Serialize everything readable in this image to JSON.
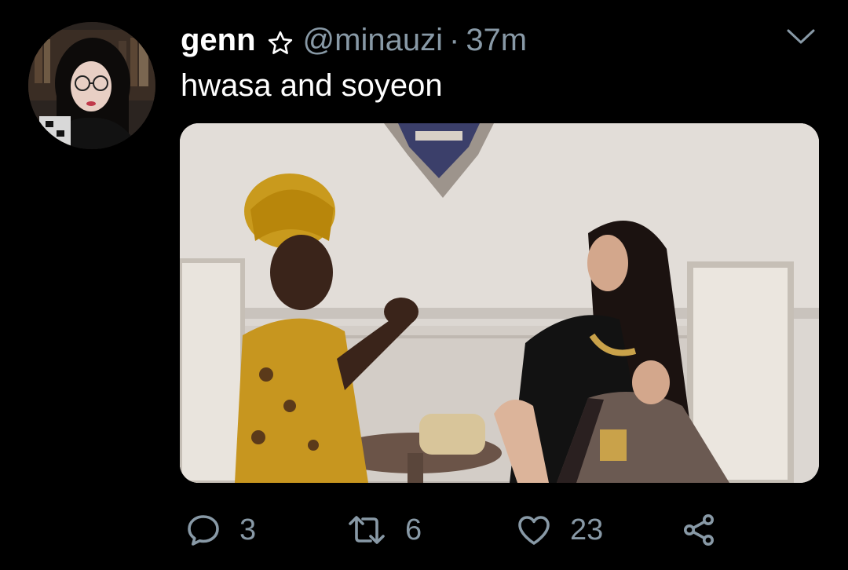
{
  "tweet": {
    "author": {
      "display_name": "genn",
      "badge_icon": "star-outline-icon",
      "handle": "@minauzi",
      "separator": "·",
      "timestamp": "37m"
    },
    "text": "hwasa and soyeon",
    "media": {
      "kind": "photo"
    },
    "actions": {
      "reply_count": "3",
      "retweet_count": "6",
      "like_count": "23"
    }
  },
  "colors": {
    "background": "#000000",
    "primary_text": "#ffffff",
    "secondary_text": "#8899a6"
  }
}
